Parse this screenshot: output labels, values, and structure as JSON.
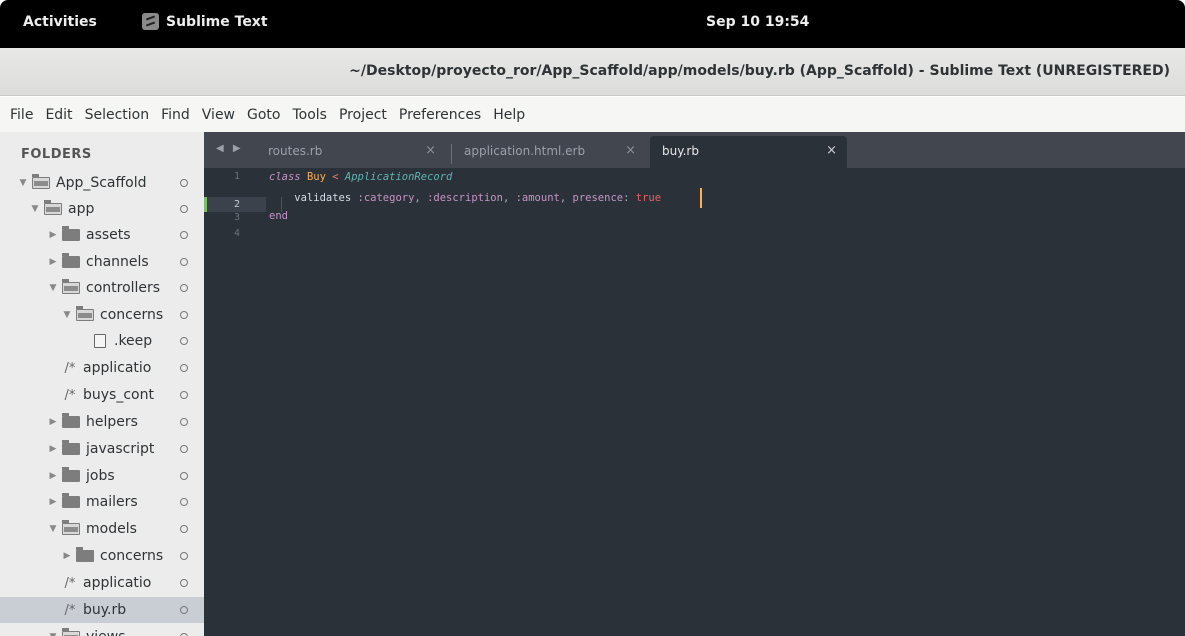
{
  "topbar": {
    "activities": "Activities",
    "app_name": "Sublime Text",
    "app_icon": "sublime-text-icon",
    "clock": "Sep 10  19:54"
  },
  "window": {
    "title": "~/Desktop/proyecto_ror/App_Scaffold/app/models/buy.rb (App_Scaffold) - Sublime Text (UNREGISTERED)"
  },
  "menu": {
    "items": [
      "File",
      "Edit",
      "Selection",
      "Find",
      "View",
      "Goto",
      "Tools",
      "Project",
      "Preferences",
      "Help"
    ]
  },
  "sidebar": {
    "title": "FOLDERS",
    "items": [
      {
        "label": "App_Scaffold",
        "type": "folder-open",
        "depth": 0
      },
      {
        "label": "app",
        "type": "folder-open",
        "depth": 1
      },
      {
        "label": "assets",
        "type": "folder-closed",
        "depth": 2
      },
      {
        "label": "channels",
        "type": "folder-closed",
        "depth": 2
      },
      {
        "label": "controllers",
        "type": "folder-open",
        "depth": 2
      },
      {
        "label": "concerns",
        "type": "folder-open",
        "depth": 3
      },
      {
        "label": ".keep",
        "type": "file",
        "depth": 4
      },
      {
        "label": "applicatio",
        "type": "code",
        "depth": 3
      },
      {
        "label": "buys_cont",
        "type": "code",
        "depth": 3
      },
      {
        "label": "helpers",
        "type": "folder-closed",
        "depth": 2
      },
      {
        "label": "javascript",
        "type": "folder-closed",
        "depth": 2
      },
      {
        "label": "jobs",
        "type": "folder-closed",
        "depth": 2
      },
      {
        "label": "mailers",
        "type": "folder-closed",
        "depth": 2
      },
      {
        "label": "models",
        "type": "folder-open",
        "depth": 2
      },
      {
        "label": "concerns",
        "type": "folder-closed",
        "depth": 3
      },
      {
        "label": "applicatio",
        "type": "code",
        "depth": 3
      },
      {
        "label": "buy.rb",
        "type": "code",
        "depth": 3,
        "selected": true
      },
      {
        "label": "views",
        "type": "folder-open",
        "depth": 2
      }
    ]
  },
  "tabs": {
    "nav_icon": "tab-navigation-arrows-icon",
    "items": [
      {
        "label": "routes.rb",
        "close": "×",
        "active": false
      },
      {
        "label": "application.html.erb",
        "close": "×",
        "active": false
      },
      {
        "label": "buy.rb",
        "close": "×",
        "active": true
      }
    ]
  },
  "editor": {
    "current_line": 2,
    "line_numbers": [
      "1",
      "2",
      "3",
      "4"
    ],
    "lines": [
      {
        "tokens": [
          {
            "t": "class",
            "c": "tok-kw"
          },
          {
            "t": " ",
            "c": ""
          },
          {
            "t": "Buy",
            "c": "tok-cls"
          },
          {
            "t": " ",
            "c": ""
          },
          {
            "t": "<",
            "c": "tok-op"
          },
          {
            "t": " ",
            "c": ""
          },
          {
            "t": "ApplicationRecord",
            "c": "tok-inh"
          }
        ]
      },
      {
        "tokens": [
          {
            "t": "    validates ",
            "c": "tok-fn"
          },
          {
            "t": ":category",
            "c": "tok-sym"
          },
          {
            "t": ", ",
            "c": "tok-punct"
          },
          {
            "t": ":description",
            "c": "tok-sym"
          },
          {
            "t": ", ",
            "c": "tok-punct"
          },
          {
            "t": ":amount",
            "c": "tok-sym"
          },
          {
            "t": ", ",
            "c": "tok-punct"
          },
          {
            "t": "presence",
            "c": "tok-sym"
          },
          {
            "t": ": ",
            "c": "tok-punct"
          },
          {
            "t": "true",
            "c": "tok-const"
          }
        ]
      },
      {
        "tokens": [
          {
            "t": "end",
            "c": "tok-end"
          }
        ]
      },
      {
        "tokens": []
      }
    ]
  },
  "colors": {
    "editor_bg": "#2b3138",
    "tabbar_bg": "#41464f",
    "sidebar_bg": "#ececec",
    "cursor": "#f9ae58"
  }
}
